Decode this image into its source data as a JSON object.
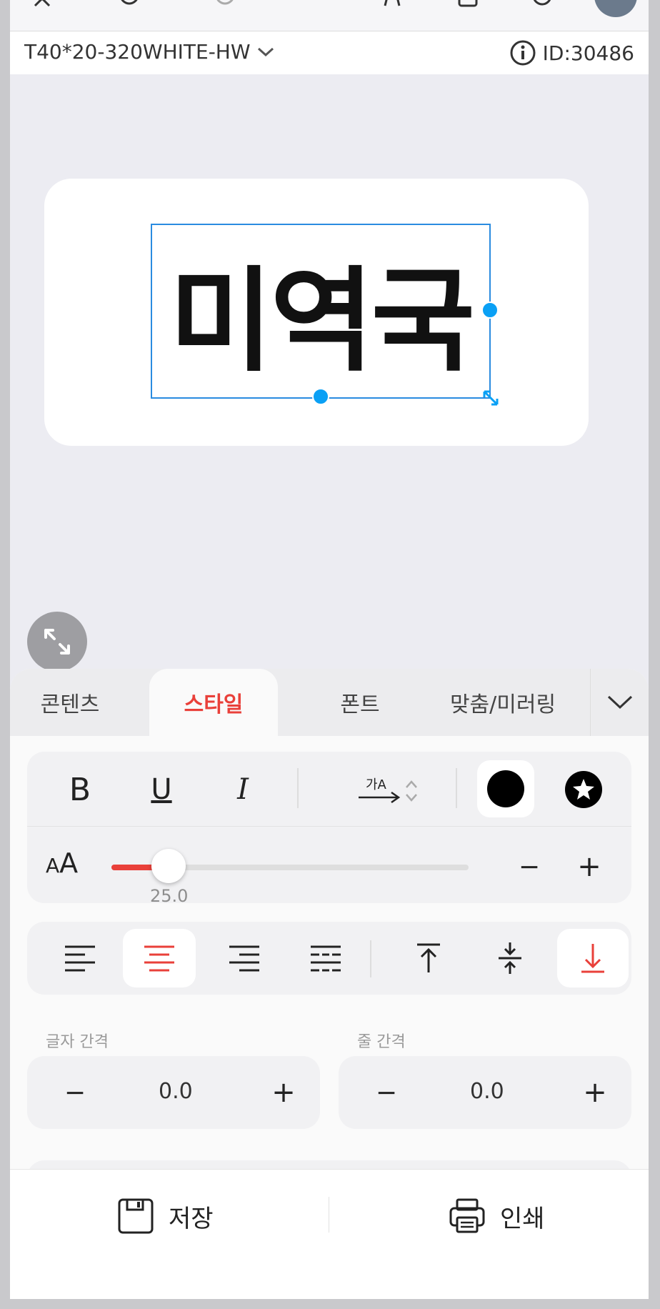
{
  "header": {
    "model": "T40*20-320WHITE-HW",
    "id_text": "ID:30486"
  },
  "label": {
    "text": "미역국"
  },
  "tabs": [
    "콘텐츠",
    "스타일",
    "폰트",
    "맞춤/미러링"
  ],
  "style": {
    "bold": "B",
    "underline": "U",
    "italic": "I",
    "direction_text": "가A",
    "font_size_icon": "AA",
    "font_size_value": "25.0",
    "font_size_fraction": 0.16,
    "minus": "−",
    "plus": "+"
  },
  "spacing": {
    "letter_label": "글자 간격",
    "letter_value": "0.0",
    "line_label": "줄 간격",
    "line_value": "0.0"
  },
  "footer": {
    "save_label": "저장",
    "print_label": "인쇄"
  },
  "colors": {
    "accent": "#e9403a",
    "handle": "#0aa0f5",
    "selection": "#2a8be0"
  }
}
